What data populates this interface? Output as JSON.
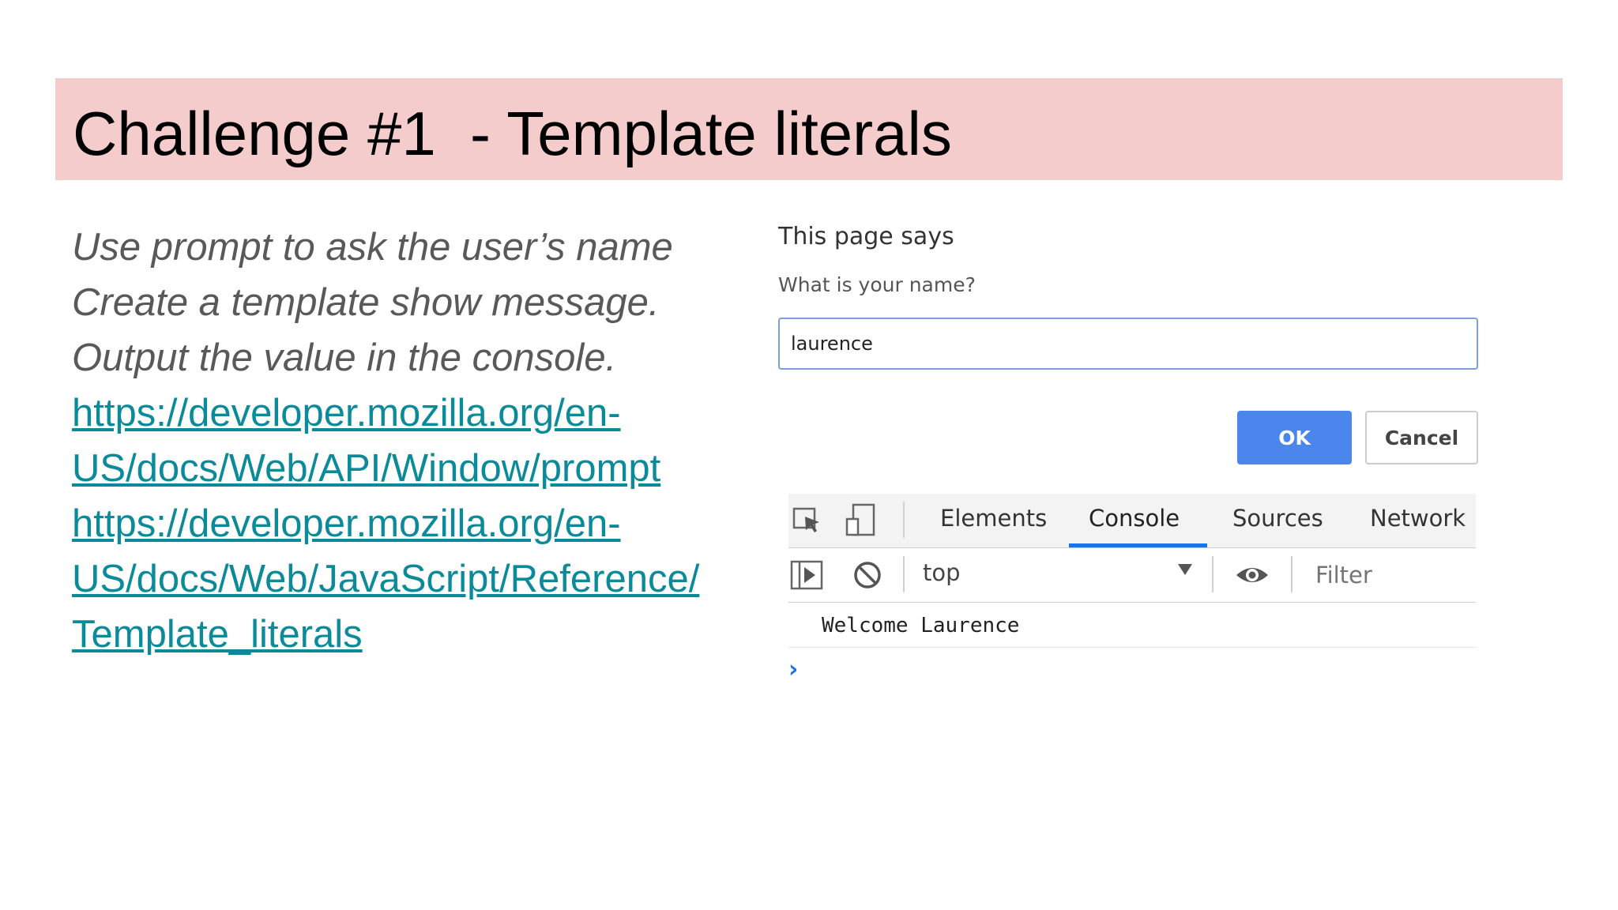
{
  "slide": {
    "title": "Challenge #1  - Template literals",
    "lines": [
      "Use prompt to ask the user’s name",
      "Create a template show message.",
      "Output the value in the console."
    ],
    "links": [
      {
        "line1": "https://developer.mozilla.org/en-",
        "line2": "US/docs/Web/API/Window/prompt"
      },
      {
        "line1": "https://developer.mozilla.org/en-",
        "line2": "US/docs/Web/JavaScript/Reference/",
        "line3": "Template_literals"
      }
    ]
  },
  "dialog": {
    "title": "This page says",
    "message": "What is your name?",
    "input_value": "laurence",
    "ok_label": "OK",
    "cancel_label": "Cancel"
  },
  "devtools": {
    "tabs": [
      "Elements",
      "Console",
      "Sources",
      "Network"
    ],
    "active_tab": "Console",
    "context": "top",
    "filter_placeholder": "Filter",
    "console_output": "Welcome Laurence",
    "prompt_symbol": "›"
  },
  "colors": {
    "title_bar": "#f4cccc",
    "link": "#0b8a99",
    "body_text": "#595959",
    "ok_button": "#4a86ec",
    "active_tab_underline": "#1a73e8"
  }
}
